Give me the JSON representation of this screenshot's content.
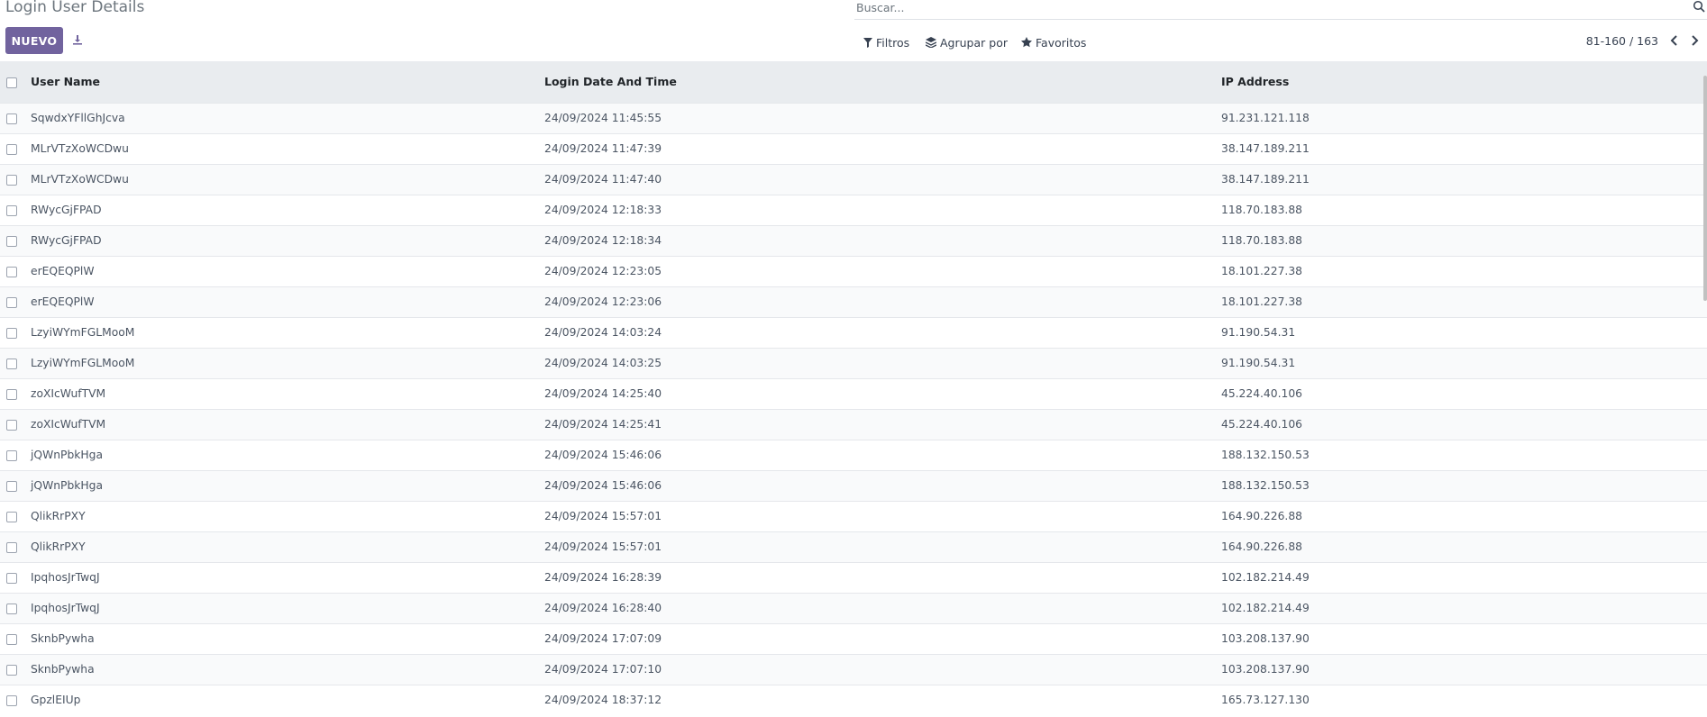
{
  "header": {
    "title": "Login User Details",
    "new_button": "NUEVO",
    "export_icon": "download-icon"
  },
  "search": {
    "placeholder": "Buscar...",
    "icon": "search-icon"
  },
  "filters": {
    "filters_label": "Filtros",
    "groupby_label": "Agrupar por",
    "favorites_label": "Favoritos"
  },
  "pager": {
    "range": "81-160 / 163"
  },
  "table": {
    "columns": [
      "User Name",
      "Login Date And Time",
      "IP Address"
    ],
    "rows": [
      {
        "user": "SqwdxYFllGhJcva",
        "date": "24/09/2024 11:45:55",
        "ip": "91.231.121.118"
      },
      {
        "user": "MLrVTzXoWCDwu",
        "date": "24/09/2024 11:47:39",
        "ip": "38.147.189.211"
      },
      {
        "user": "MLrVTzXoWCDwu",
        "date": "24/09/2024 11:47:40",
        "ip": "38.147.189.211"
      },
      {
        "user": "RWycGjFPAD",
        "date": "24/09/2024 12:18:33",
        "ip": "118.70.183.88"
      },
      {
        "user": "RWycGjFPAD",
        "date": "24/09/2024 12:18:34",
        "ip": "118.70.183.88"
      },
      {
        "user": "erEQEQPlW",
        "date": "24/09/2024 12:23:05",
        "ip": "18.101.227.38"
      },
      {
        "user": "erEQEQPlW",
        "date": "24/09/2024 12:23:06",
        "ip": "18.101.227.38"
      },
      {
        "user": "LzyiWYmFGLMooM",
        "date": "24/09/2024 14:03:24",
        "ip": "91.190.54.31"
      },
      {
        "user": "LzyiWYmFGLMooM",
        "date": "24/09/2024 14:03:25",
        "ip": "91.190.54.31"
      },
      {
        "user": "zoXIcWufTVM",
        "date": "24/09/2024 14:25:40",
        "ip": "45.224.40.106"
      },
      {
        "user": "zoXIcWufTVM",
        "date": "24/09/2024 14:25:41",
        "ip": "45.224.40.106"
      },
      {
        "user": "jQWnPbkHga",
        "date": "24/09/2024 15:46:06",
        "ip": "188.132.150.53"
      },
      {
        "user": "jQWnPbkHga",
        "date": "24/09/2024 15:46:06",
        "ip": "188.132.150.53"
      },
      {
        "user": "QlikRrPXY",
        "date": "24/09/2024 15:57:01",
        "ip": "164.90.226.88"
      },
      {
        "user": "QlikRrPXY",
        "date": "24/09/2024 15:57:01",
        "ip": "164.90.226.88"
      },
      {
        "user": "IpqhosJrTwqJ",
        "date": "24/09/2024 16:28:39",
        "ip": "102.182.214.49"
      },
      {
        "user": "IpqhosJrTwqJ",
        "date": "24/09/2024 16:28:40",
        "ip": "102.182.214.49"
      },
      {
        "user": "SknbPywha",
        "date": "24/09/2024 17:07:09",
        "ip": "103.208.137.90"
      },
      {
        "user": "SknbPywha",
        "date": "24/09/2024 17:07:10",
        "ip": "103.208.137.90"
      },
      {
        "user": "GpzlEIUp",
        "date": "24/09/2024 18:37:12",
        "ip": "165.73.127.130"
      }
    ]
  },
  "colors": {
    "primary": "#71639e",
    "header_bg": "#e9ecef"
  }
}
